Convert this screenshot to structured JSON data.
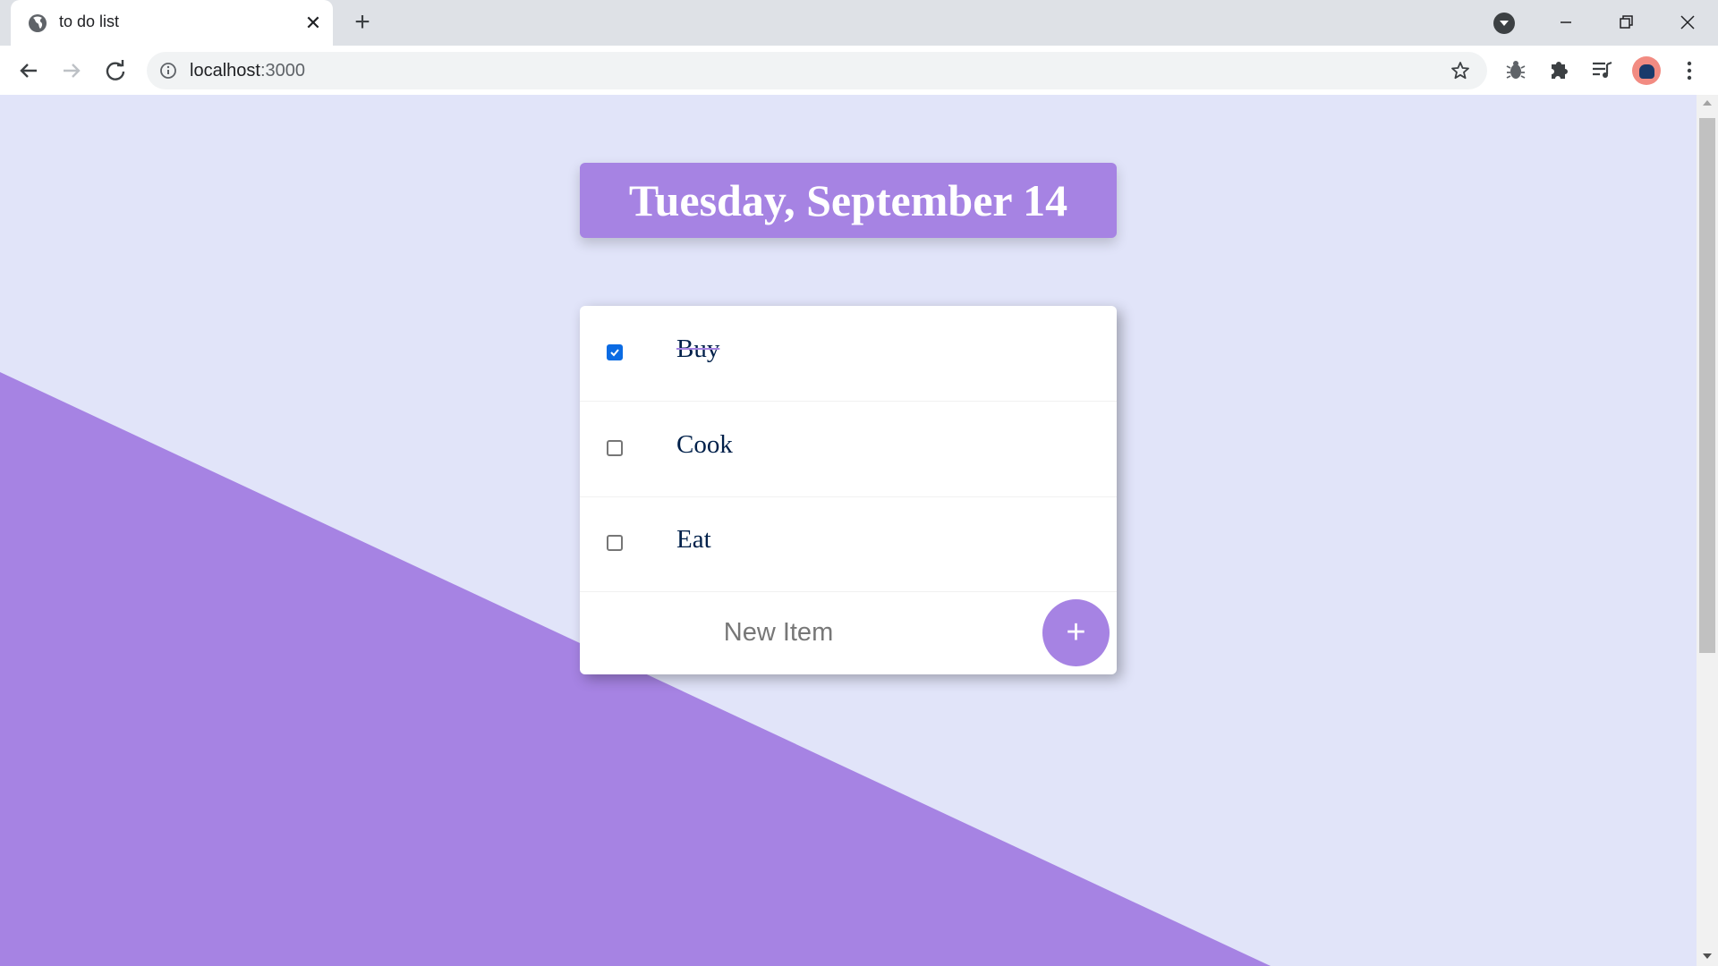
{
  "browser": {
    "tab_title": "to do list",
    "url_host": "localhost",
    "url_port": ":3000"
  },
  "page": {
    "heading": "Tuesday, September 14",
    "items": [
      {
        "text": "Buy",
        "checked": true
      },
      {
        "text": "Cook",
        "checked": false
      },
      {
        "text": "Eat",
        "checked": false
      }
    ],
    "new_item_placeholder": "New Item",
    "add_button_label": "+"
  },
  "colors": {
    "accent": "#A683E3",
    "background": "#E1E4F9",
    "text": "#00204A",
    "checkbox_checked": "#0B6BE3"
  }
}
